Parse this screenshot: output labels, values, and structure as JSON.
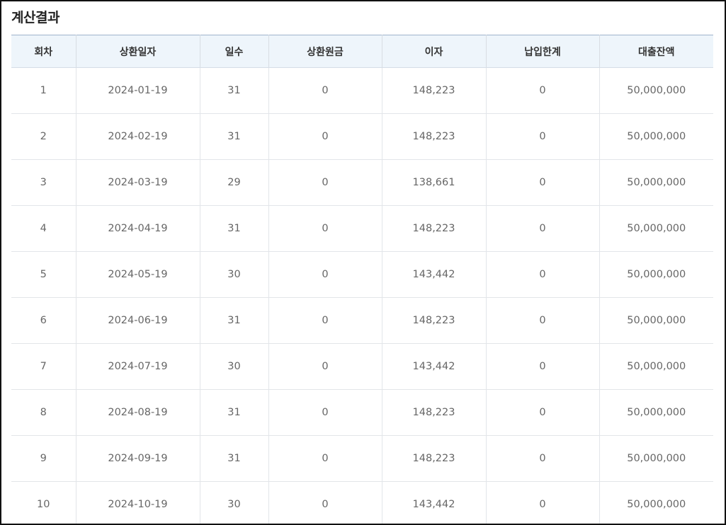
{
  "title": "계산결과",
  "table": {
    "headers": [
      "회차",
      "상환일자",
      "일수",
      "상환원금",
      "이자",
      "납입한계",
      "대출잔액"
    ],
    "rows": [
      [
        "1",
        "2024-01-19",
        "31",
        "0",
        "148,223",
        "0",
        "50,000,000"
      ],
      [
        "2",
        "2024-02-19",
        "31",
        "0",
        "148,223",
        "0",
        "50,000,000"
      ],
      [
        "3",
        "2024-03-19",
        "29",
        "0",
        "138,661",
        "0",
        "50,000,000"
      ],
      [
        "4",
        "2024-04-19",
        "31",
        "0",
        "148,223",
        "0",
        "50,000,000"
      ],
      [
        "5",
        "2024-05-19",
        "30",
        "0",
        "143,442",
        "0",
        "50,000,000"
      ],
      [
        "6",
        "2024-06-19",
        "31",
        "0",
        "148,223",
        "0",
        "50,000,000"
      ],
      [
        "7",
        "2024-07-19",
        "30",
        "0",
        "143,442",
        "0",
        "50,000,000"
      ],
      [
        "8",
        "2024-08-19",
        "31",
        "0",
        "148,223",
        "0",
        "50,000,000"
      ],
      [
        "9",
        "2024-09-19",
        "31",
        "0",
        "148,223",
        "0",
        "50,000,000"
      ],
      [
        "10",
        "2024-10-19",
        "30",
        "0",
        "143,442",
        "0",
        "50,000,000"
      ]
    ]
  }
}
